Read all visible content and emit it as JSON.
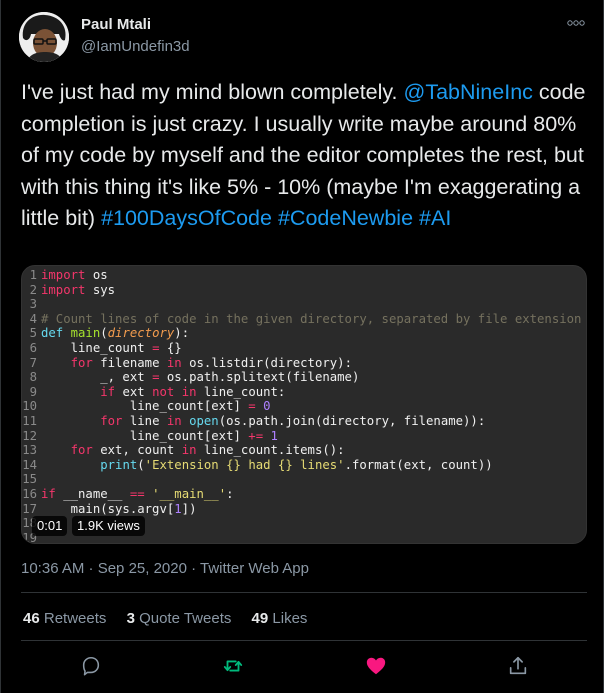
{
  "user": {
    "name": "Paul Mtali",
    "handle": "@IamUndefin3d"
  },
  "tweet": {
    "text_before_mention": "I've just had my mind blown completely. ",
    "mention": "@TabNineInc",
    "text_after_mention": " code completion is just crazy. I usually write maybe around 80% of my code by myself and the editor completes the rest, but with this thing it's like 5% - 10% (maybe I'm exaggerating a little bit) ",
    "hashtags": [
      "#100DaysOfCode",
      "#CodeNewbie",
      "#AI"
    ]
  },
  "media": {
    "elapsed": "0:01",
    "views": "1.9K views",
    "code_lines": [
      [
        {
          "c": "k",
          "t": "import"
        },
        {
          "c": "t",
          "t": " os"
        }
      ],
      [
        {
          "c": "k",
          "t": "import"
        },
        {
          "c": "t",
          "t": " sys"
        }
      ],
      [],
      [
        {
          "c": "c",
          "t": "# Count lines of code in the given directory, separated by file extension"
        }
      ],
      [
        {
          "c": "b",
          "t": "def"
        },
        {
          "c": "t",
          "t": " "
        },
        {
          "c": "f",
          "t": "main"
        },
        {
          "c": "t",
          "t": "("
        },
        {
          "c": "p",
          "t": "directory"
        },
        {
          "c": "t",
          "t": "):"
        }
      ],
      [
        {
          "c": "t",
          "t": "    line_count "
        },
        {
          "c": "k",
          "t": "="
        },
        {
          "c": "t",
          "t": " {}"
        }
      ],
      [
        {
          "c": "t",
          "t": "    "
        },
        {
          "c": "k",
          "t": "for"
        },
        {
          "c": "t",
          "t": " filename "
        },
        {
          "c": "k",
          "t": "in"
        },
        {
          "c": "t",
          "t": " os.listdir(directory):"
        }
      ],
      [
        {
          "c": "t",
          "t": "        _, ext "
        },
        {
          "c": "k",
          "t": "="
        },
        {
          "c": "t",
          "t": " os.path.splitext(filename)"
        }
      ],
      [
        {
          "c": "t",
          "t": "        "
        },
        {
          "c": "k",
          "t": "if"
        },
        {
          "c": "t",
          "t": " ext "
        },
        {
          "c": "k",
          "t": "not in"
        },
        {
          "c": "t",
          "t": " line_count:"
        }
      ],
      [
        {
          "c": "t",
          "t": "            line_count[ext] "
        },
        {
          "c": "k",
          "t": "="
        },
        {
          "c": "t",
          "t": " "
        },
        {
          "c": "n",
          "t": "0"
        }
      ],
      [
        {
          "c": "t",
          "t": "        "
        },
        {
          "c": "k",
          "t": "for"
        },
        {
          "c": "t",
          "t": " line "
        },
        {
          "c": "k",
          "t": "in"
        },
        {
          "c": "t",
          "t": " "
        },
        {
          "c": "b",
          "t": "open"
        },
        {
          "c": "t",
          "t": "(os.path.join(directory, filename)):"
        }
      ],
      [
        {
          "c": "t",
          "t": "            line_count[ext] "
        },
        {
          "c": "k",
          "t": "+="
        },
        {
          "c": "t",
          "t": " "
        },
        {
          "c": "n",
          "t": "1"
        }
      ],
      [
        {
          "c": "t",
          "t": "    "
        },
        {
          "c": "k",
          "t": "for"
        },
        {
          "c": "t",
          "t": " ext, count "
        },
        {
          "c": "k",
          "t": "in"
        },
        {
          "c": "t",
          "t": " line_count.items():"
        }
      ],
      [
        {
          "c": "t",
          "t": "        "
        },
        {
          "c": "b",
          "t": "print"
        },
        {
          "c": "t",
          "t": "("
        },
        {
          "c": "s",
          "t": "'Extension {} had {} lines'"
        },
        {
          "c": "t",
          "t": ".format(ext, count))"
        }
      ],
      [],
      [
        {
          "c": "k",
          "t": "if"
        },
        {
          "c": "t",
          "t": " __name__ "
        },
        {
          "c": "k",
          "t": "=="
        },
        {
          "c": "t",
          "t": " "
        },
        {
          "c": "s",
          "t": "'__main__'"
        },
        {
          "c": "t",
          "t": ":"
        }
      ],
      [
        {
          "c": "t",
          "t": "    main(sys.argv["
        },
        {
          "c": "n",
          "t": "1"
        },
        {
          "c": "t",
          "t": "])"
        }
      ],
      [],
      []
    ]
  },
  "timestamp": "10:36 AM · Sep 25, 2020 · Twitter Web App",
  "stats": {
    "retweets": {
      "count": "46",
      "label": "Retweets"
    },
    "quotes": {
      "count": "3",
      "label": "Quote Tweets"
    },
    "likes": {
      "count": "49",
      "label": "Likes"
    }
  },
  "colors": {
    "link": "#1d9bf0",
    "retweet": "#00ba7c",
    "like": "#f91880",
    "muted": "#8b98a5"
  }
}
